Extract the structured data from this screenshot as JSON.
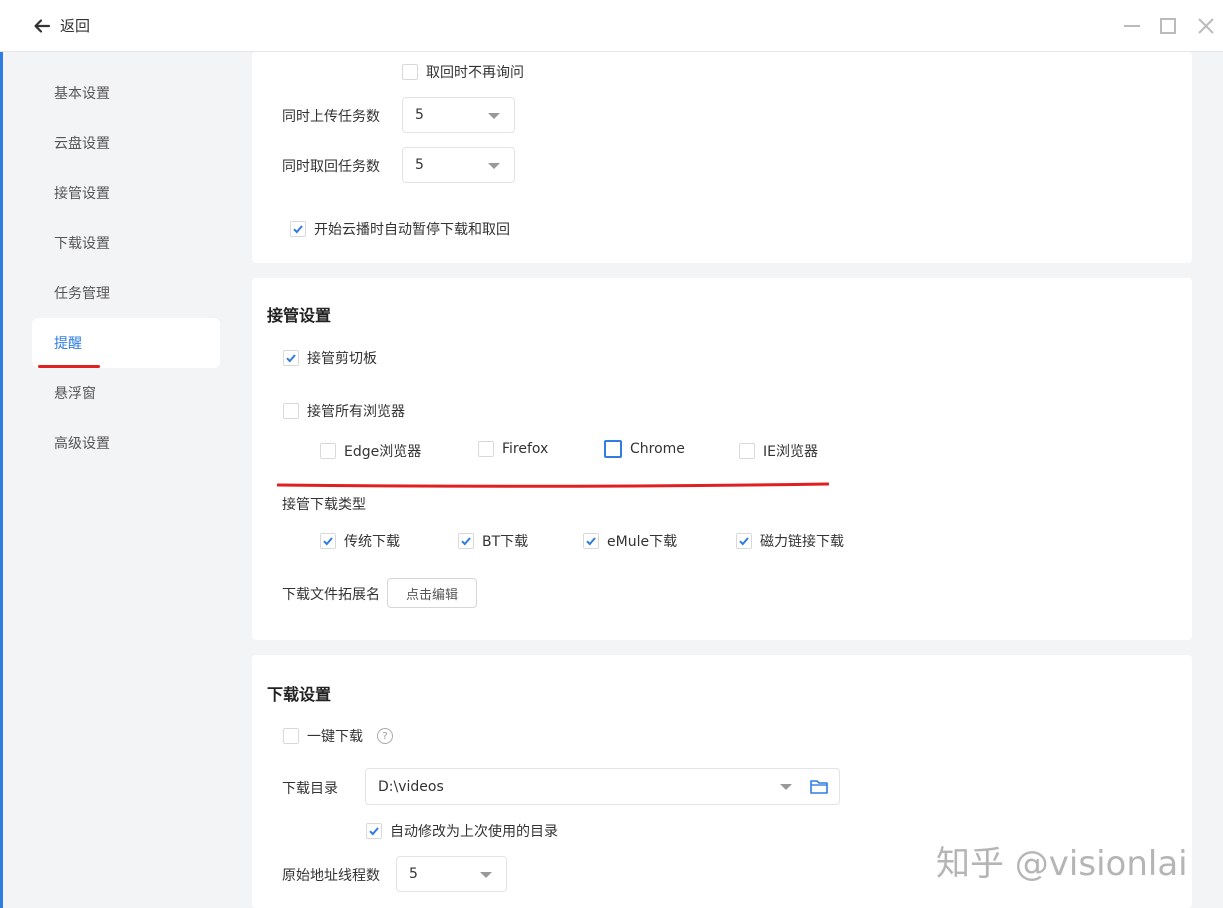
{
  "titlebar": {
    "back_label": "返回"
  },
  "sidebar": {
    "items": [
      {
        "label": "基本设置"
      },
      {
        "label": "云盘设置"
      },
      {
        "label": "接管设置"
      },
      {
        "label": "下载设置"
      },
      {
        "label": "任务管理"
      },
      {
        "label": "提醒"
      },
      {
        "label": "悬浮窗"
      },
      {
        "label": "高级设置"
      }
    ],
    "active_index": 5
  },
  "cloud_card": {
    "no_ask_label": "取回时不再询问",
    "upload_tasks_label": "同时上传任务数",
    "upload_tasks_value": "5",
    "retrieve_tasks_label": "同时取回任务数",
    "retrieve_tasks_value": "5",
    "auto_pause_label": "开始云播时自动暂停下载和取回"
  },
  "takeover_card": {
    "title": "接管设置",
    "clipboard_label": "接管剪切板",
    "all_browsers_label": "接管所有浏览器",
    "browsers": [
      {
        "label": "Edge浏览器",
        "checked": false
      },
      {
        "label": "Firefox",
        "checked": false
      },
      {
        "label": "Chrome",
        "checked": false
      },
      {
        "label": "IE浏览器",
        "checked": false
      }
    ],
    "download_types_label": "接管下载类型",
    "download_types": [
      {
        "label": "传统下载",
        "checked": true
      },
      {
        "label": "BT下载",
        "checked": true
      },
      {
        "label": "eMule下载",
        "checked": true
      },
      {
        "label": "磁力链接下载",
        "checked": true
      }
    ],
    "extension_label": "下载文件拓展名",
    "edit_button": "点击编辑"
  },
  "download_card": {
    "title": "下载设置",
    "one_click_label": "一键下载",
    "help_glyph": "?",
    "dir_label": "下载目录",
    "dir_value": "D:\\videos",
    "auto_modify_label": "自动修改为上次使用的目录",
    "threads_label": "原始地址线程数",
    "threads_value": "5"
  },
  "watermark": "知乎 @visionlai",
  "colors": {
    "accent": "#2f7de1",
    "annotation_red": "#e02020"
  }
}
